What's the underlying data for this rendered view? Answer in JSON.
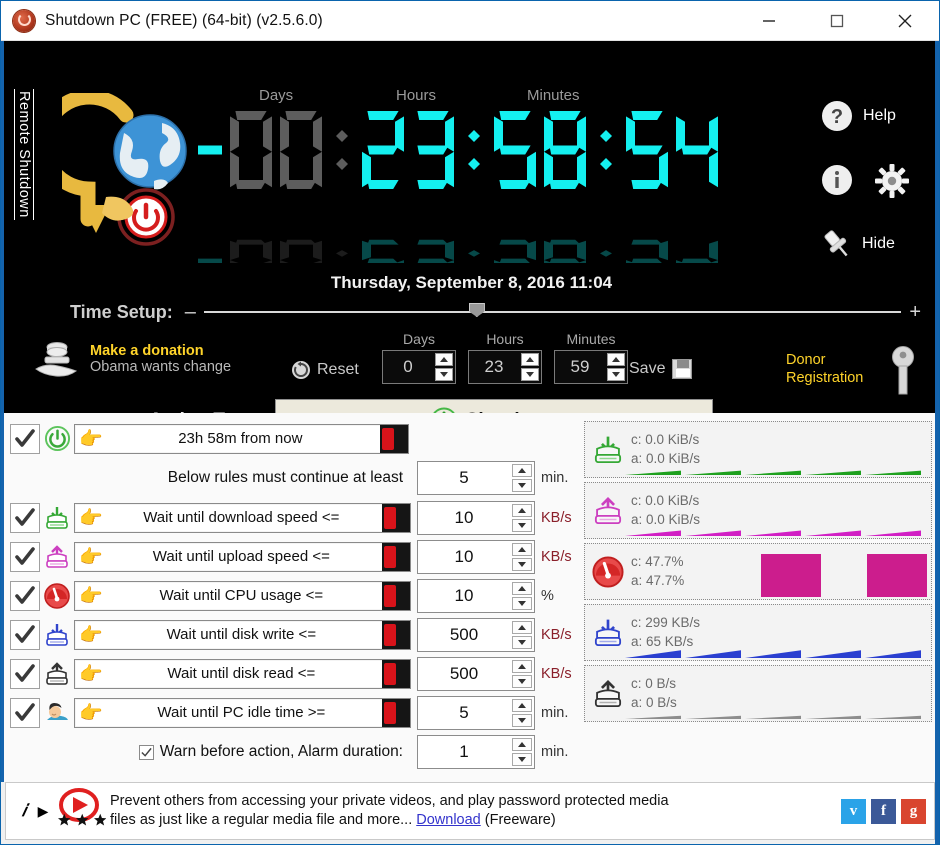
{
  "window": {
    "title": "Shutdown PC (FREE) (64-bit) (v2.5.6.0)",
    "app_icon": "power-button-icon",
    "minimize": "—",
    "maximize": "□",
    "close": "✕"
  },
  "side_tab": {
    "label": "Remote Shutdown"
  },
  "clock": {
    "captions": {
      "days": "Days",
      "hours": "Hours",
      "minutes": "Minutes"
    },
    "sign": "-",
    "days": "00",
    "hours": "23",
    "minutes": "58",
    "seconds": "54",
    "separator": ":",
    "active_color": "#14f0f0",
    "inactive_color": "#5d5d5d"
  },
  "header_buttons": {
    "help": {
      "label": "Help",
      "icon": "question-circle-icon"
    },
    "info": {
      "icon": "info-circle-icon"
    },
    "settings": {
      "icon": "gear-icon"
    },
    "hide": {
      "label": "Hide",
      "icon": "pushpin-icon"
    }
  },
  "date_line": "Thursday, September 8, 2016 11:04",
  "time_setup": {
    "label": "Time Setup:",
    "minus": "–",
    "plus": "+",
    "slider_position_percent": 38
  },
  "donation": {
    "line1": "Make  a donation",
    "line2": "Obama  wants change",
    "icon": "hand-coin-icon",
    "color": "#ffd42a"
  },
  "reset": {
    "label": "Reset",
    "icon": "refresh-circle-icon"
  },
  "spinners": [
    {
      "caption": "Days",
      "value": "0"
    },
    {
      "caption": "Hours",
      "value": "23"
    },
    {
      "caption": "Minutes",
      "value": "59"
    }
  ],
  "save": {
    "label": "Save",
    "icon": "floppy-disk-icon"
  },
  "donor_registration": {
    "line1": "Donor",
    "line2": "Registration",
    "icon": "key-icon",
    "color": "#ffd42a"
  },
  "action_type": {
    "label": "Action Type:",
    "selected": "Shutdown",
    "icon": "green-power-icon",
    "dropdown_icon": "chevron-down-icon"
  },
  "rules": {
    "primary": {
      "checked": true,
      "icon": "green-power-icon",
      "hand_icon": "pointing-hand-icon",
      "text": "23h 58m from now"
    },
    "at_least": {
      "text": "Below rules must continue at least",
      "value": "5",
      "unit": "min."
    },
    "items": [
      {
        "checked": true,
        "icon": "download-green-icon",
        "hand_icon": "pointing-hand-icon",
        "text": "Wait until download speed <=",
        "value": "10",
        "unit": "KB/s",
        "unit_color": "red"
      },
      {
        "checked": true,
        "icon": "upload-magenta-icon",
        "hand_icon": "pointing-hand-icon",
        "text": "Wait until upload speed <=",
        "value": "10",
        "unit": "KB/s",
        "unit_color": "red"
      },
      {
        "checked": true,
        "icon": "cpu-gauge-red-icon",
        "hand_icon": "pointing-hand-icon",
        "text": "Wait until CPU usage <=",
        "value": "10",
        "unit": "%",
        "unit_color": "dark"
      },
      {
        "checked": true,
        "icon": "disk-write-blue-icon",
        "hand_icon": "pointing-hand-icon",
        "text": "Wait until disk write <=",
        "value": "500",
        "unit": "KB/s",
        "unit_color": "red"
      },
      {
        "checked": true,
        "icon": "disk-read-gray-icon",
        "hand_icon": "pointing-hand-icon",
        "text": "Wait until disk read <=",
        "value": "500",
        "unit": "KB/s",
        "unit_color": "red"
      },
      {
        "checked": true,
        "icon": "sleeping-person-icon",
        "hand_icon": "pointing-hand-icon",
        "text": "Wait until PC idle time >=",
        "value": "5",
        "unit": "min.",
        "unit_color": "dark"
      }
    ],
    "warn": {
      "checked": true,
      "text": "Warn before action, Alarm duration:",
      "value": "1",
      "unit": "min."
    }
  },
  "chart_data": [
    {
      "type": "area",
      "name": "download",
      "icon": "download-green-icon",
      "color": "#1ea01e",
      "current_label": "c: 0.0 KiB/s",
      "average_label": "a: 0.0 KiB/s",
      "current": 0.0,
      "average": 0.0,
      "unit": "KiB/s",
      "values": [
        0,
        1,
        0,
        1,
        0,
        1,
        0,
        1,
        0,
        1
      ],
      "pattern": "sawtooth",
      "baseline_percent": 8
    },
    {
      "type": "area",
      "name": "upload",
      "icon": "upload-magenta-icon",
      "color": "#d11fc4",
      "current_label": "c: 0.0 KiB/s",
      "average_label": "a: 0.0 KiB/s",
      "current": 0.0,
      "average": 0.0,
      "unit": "KiB/s",
      "values": [
        0,
        1,
        0,
        1,
        0,
        1,
        0,
        1,
        0,
        1
      ],
      "pattern": "sawtooth",
      "baseline_percent": 10
    },
    {
      "type": "bar",
      "name": "cpu",
      "icon": "cpu-gauge-red-icon",
      "color": "#cc1d8d",
      "current_label": "c: 47.7%",
      "average_label": "a: 47.7%",
      "current": 47.7,
      "average": 47.7,
      "unit": "%",
      "values": [
        0,
        0,
        0,
        48,
        48,
        0,
        0,
        48,
        48,
        0
      ],
      "pattern": "blocks"
    },
    {
      "type": "area",
      "name": "disk-write",
      "icon": "disk-write-blue-icon",
      "color": "#2a3fd0",
      "current_label": "c: 299 KB/s",
      "average_label": "a: 65 KB/s",
      "current": 299,
      "average": 65,
      "unit": "KB/s",
      "values": [
        0,
        1,
        0,
        1,
        0,
        1,
        0,
        1
      ],
      "pattern": "sawtooth",
      "baseline_percent": 14
    },
    {
      "type": "area",
      "name": "disk-read",
      "icon": "disk-read-gray-icon",
      "color": "#8d8d8d",
      "current_label": "c: 0 B/s",
      "average_label": "a: 0 B/s",
      "current": 0,
      "average": 0,
      "unit": "B/s",
      "values": [
        0,
        1,
        0,
        1,
        0,
        1,
        0,
        1
      ],
      "pattern": "sawtooth",
      "baseline_percent": 6
    }
  ],
  "footer": {
    "info_icon": "info-italic-icon",
    "play_icon": "play-triangle-icon",
    "logo_icon": "red-play-circle-stars-icon",
    "text_line1": "Prevent others from accessing your private videos, and play password protected media",
    "text_line2_pre": "files as just like a regular media file and more... ",
    "download_link": "Download",
    "text_line2_post": " (Freeware)",
    "socials": [
      {
        "name": "twitter",
        "glyph": "ᴠ",
        "color": "#2aa3e8"
      },
      {
        "name": "facebook",
        "glyph": "f",
        "color": "#3b5998"
      },
      {
        "name": "google-plus",
        "glyph": "g",
        "color": "#d9452f"
      }
    ]
  }
}
